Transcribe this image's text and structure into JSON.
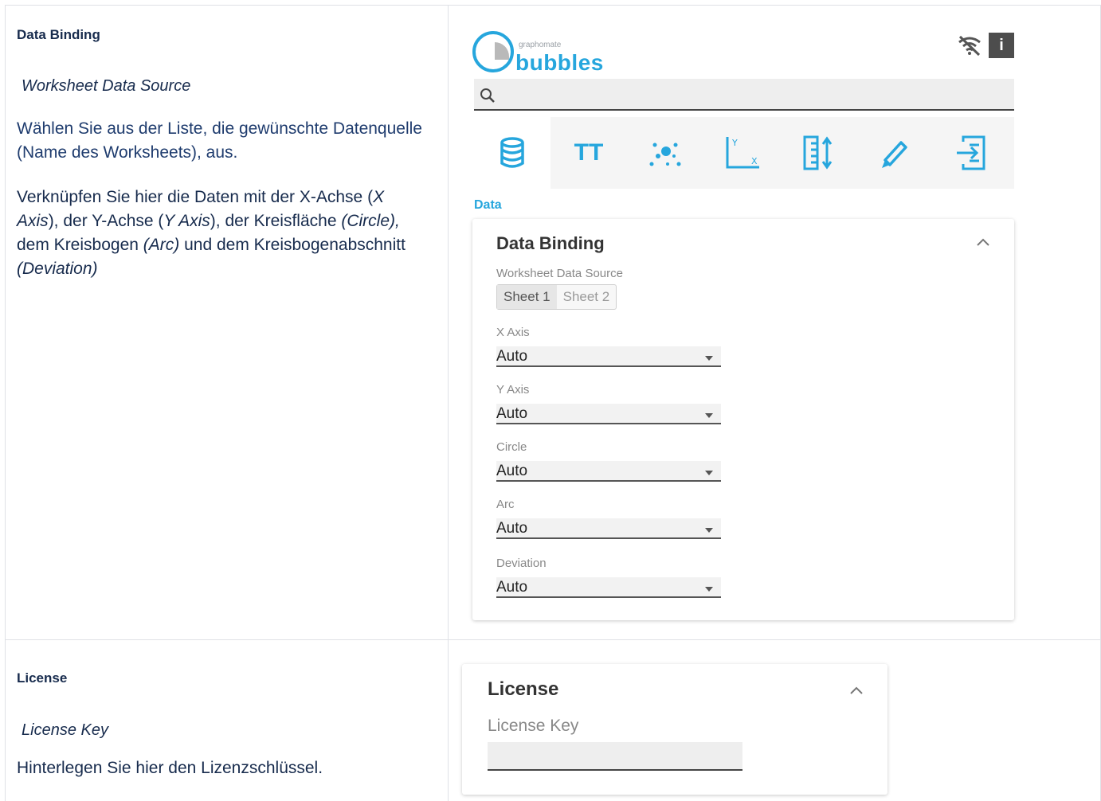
{
  "row1": {
    "title": "Data Binding",
    "subtitle": "Worksheet Data Source",
    "para_blue": "Wählen Sie aus der Liste, die gewünschte Datenquelle (Name des Worksheets), aus.",
    "para": {
      "t1": "Verknüpfen Sie hier die Daten mit der X-Achse (",
      "i1": "X Axis",
      "t2": "), der Y-Achse (",
      "i2": "Y Axis",
      "t3": "), der Kreisfläche ",
      "i3": "(Circle),",
      "t4": " dem Kreisbogen ",
      "i4": "(Arc)",
      "t5": " und dem Kreisbogenabschnitt ",
      "i5": "(Deviation)"
    }
  },
  "row2": {
    "title": "License",
    "subtitle": "License Key",
    "para": "Hinterlegen Sie hier den Lizenzschlüssel."
  },
  "logo": {
    "small": "graphomate",
    "big": "bubbles"
  },
  "top_icons": {
    "wifi": "wifi-off-icon",
    "info": "i"
  },
  "search": {
    "placeholder": "",
    "value": ""
  },
  "tabs": [
    {
      "icon": "database-icon"
    },
    {
      "icon": "text-size-icon",
      "glyph": "TT"
    },
    {
      "icon": "scatter-icon"
    },
    {
      "icon": "axis-icon"
    },
    {
      "icon": "sort-columns-icon"
    },
    {
      "icon": "pencil-icon"
    },
    {
      "icon": "export-icon"
    }
  ],
  "section_label": "Data",
  "card": {
    "title": "Data Binding",
    "source_label": "Worksheet Data Source",
    "sheets": [
      "Sheet 1",
      "Sheet 2"
    ],
    "fields": [
      {
        "label": "X Axis",
        "value": "Auto"
      },
      {
        "label": "Y Axis",
        "value": "Auto"
      },
      {
        "label": "Circle",
        "value": "Auto"
      },
      {
        "label": "Arc",
        "value": "Auto"
      },
      {
        "label": "Deviation",
        "value": "Auto"
      }
    ]
  },
  "license_card": {
    "title": "License",
    "key_label": "License Key",
    "key_value": ""
  },
  "colors": {
    "accent": "#26a6dd",
    "text": "#172b4d",
    "blue_text": "#1f3c6e"
  }
}
